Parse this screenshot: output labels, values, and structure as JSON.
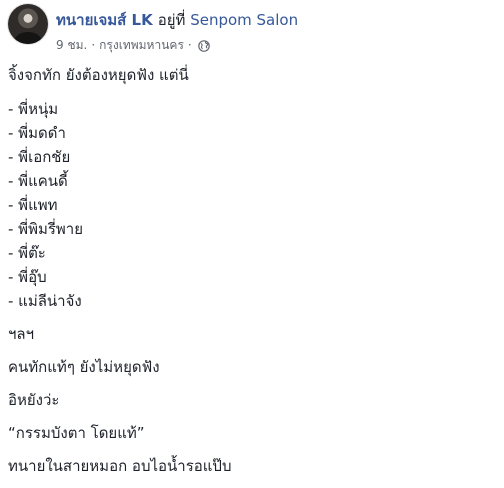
{
  "post": {
    "author": "ทนายเจมส์ LK",
    "at_text": "อยู่ที่",
    "place": "Senpom Salon",
    "time": "9 ชม.",
    "city": "กรุงเทพมหานคร",
    "privacy_icon": "globe-icon",
    "intro": "จิ้งจกทัก ยังต้องหยุดฟัง แต่นี่",
    "list": [
      "- พี่หนุ่ม",
      "- พี่มดดำ",
      "- พี่เอกชัย",
      "- พี่แคนดี้",
      "- พี่แพท",
      "- พี่พิมรี่พาย",
      "- พี่ต๊ะ",
      "- พี่อุ๊บ",
      "- แม่ลีน่าจัง"
    ],
    "tail": [
      "ฯลฯ",
      "คนทักแท้ๆ ยังไม่หยุดฟัง",
      "อิหยังว่ะ",
      "“กรรมบังตา โดยแท้”",
      "ทนายในสายหมอก อบไอน้ำรอแป๊บ"
    ]
  }
}
